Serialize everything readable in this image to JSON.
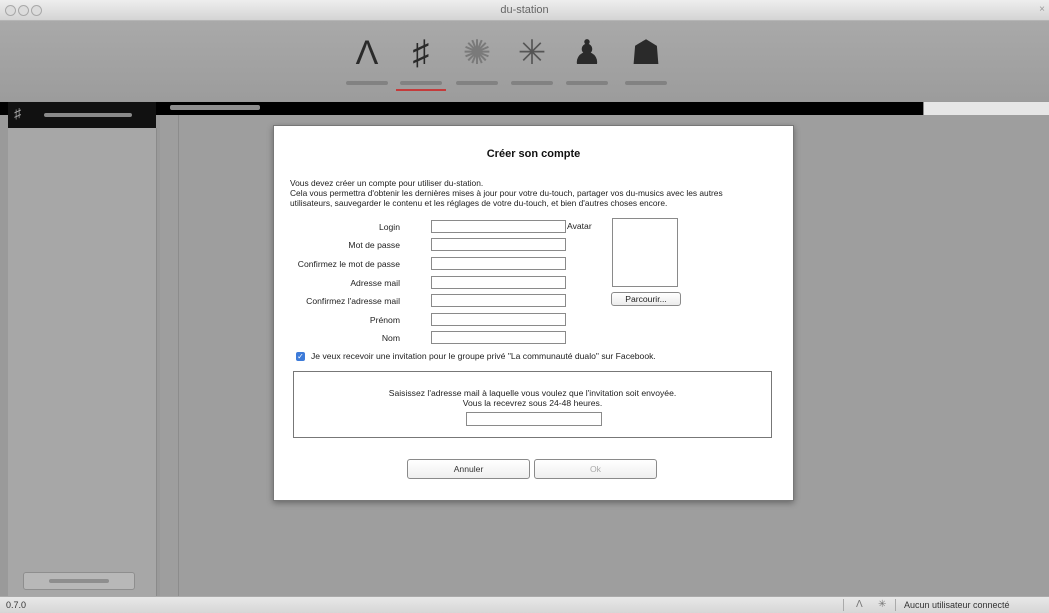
{
  "window": {
    "title": "du-station",
    "version": "0.7.0"
  },
  "toolbar": {
    "items": [
      {
        "icon": "du-touch-icon",
        "glyph": "Λ"
      },
      {
        "icon": "du-music-icon",
        "glyph": "♯",
        "active": true
      },
      {
        "icon": "du-sound-icon",
        "glyph": "✺"
      },
      {
        "icon": "du-station-icon",
        "glyph": "✳"
      },
      {
        "icon": "synth-icon",
        "glyph": "♟"
      },
      {
        "icon": "du-community-icon",
        "glyph": "☗"
      }
    ]
  },
  "status": {
    "user": "Aucun utilisateur connecté"
  },
  "dialog": {
    "title": "Créer son compte",
    "intro": [
      "Vous devez créer un compte pour utiliser du-station.",
      "Cela vous permettra d'obtenir les dernières mises à jour pour votre du-touch, partager vos du-musics avec les autres",
      "utilisateurs, sauvegarder le contenu et les réglages de votre du-touch, et bien d'autres choses encore."
    ],
    "fields": [
      {
        "label": "Login",
        "value": ""
      },
      {
        "label": "Mot de passe",
        "value": ""
      },
      {
        "label": "Confirmez le mot de passe",
        "value": ""
      },
      {
        "label": "Adresse mail",
        "value": ""
      },
      {
        "label": "Confirmez l'adresse mail",
        "value": ""
      },
      {
        "label": "Prénom",
        "value": ""
      },
      {
        "label": "Nom",
        "value": ""
      }
    ],
    "avatar_label": "Avatar",
    "browse_label": "Parcourir...",
    "checkbox": {
      "checked": true,
      "label": "Je veux recevoir une invitation pour le groupe privé \"La communauté dualo\" sur Facebook."
    },
    "invite": {
      "line1": "Saisissez l'adresse mail à laquelle vous voulez que l'invitation soit envoyée.",
      "line2": "Vous la recevrez sous 24-48 heures.",
      "value": ""
    },
    "cancel_label": "Annuler",
    "ok_label": "Ok"
  },
  "colors": {
    "checkbox_accent": "#3d7bd9",
    "active_tab_underline": "#c43b3b"
  }
}
